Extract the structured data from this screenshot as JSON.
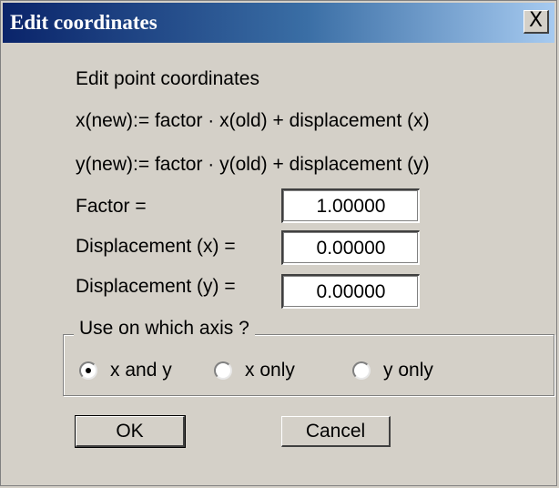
{
  "window": {
    "title": "Edit coordinates",
    "close_label": "X"
  },
  "content": {
    "heading": "Edit point coordinates",
    "formula_x": "x(new):= factor · x(old) + displacement (x)",
    "formula_y": "y(new):= factor · y(old) + displacement (y)"
  },
  "fields": {
    "factor": {
      "label": "Factor =",
      "value": "1.00000"
    },
    "disp_x": {
      "label": "Displacement (x) =",
      "value": "0.00000"
    },
    "disp_y": {
      "label": "Displacement (y) =",
      "value": "0.00000"
    }
  },
  "axis_group": {
    "legend": "Use on which axis ?",
    "options": [
      {
        "label": "x and y",
        "checked": true
      },
      {
        "label": "x only",
        "checked": false
      },
      {
        "label": "y only",
        "checked": false
      }
    ]
  },
  "buttons": {
    "ok": "OK",
    "cancel": "Cancel"
  }
}
